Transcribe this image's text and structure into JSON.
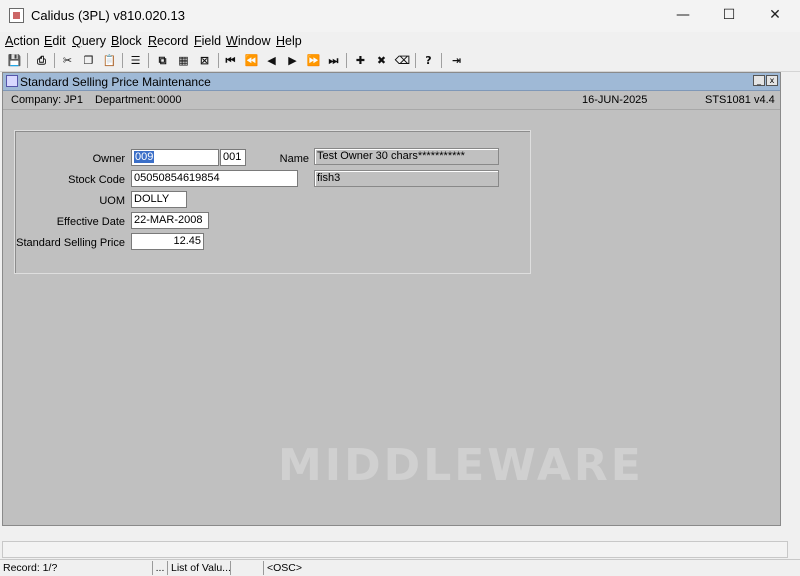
{
  "window": {
    "title": "Calidus (3PL) v810.020.13",
    "minimize_glyph": "—",
    "maximize_glyph": "☐",
    "close_glyph": "✕"
  },
  "menu": [
    {
      "accel": "A",
      "rest": "ction"
    },
    {
      "accel": "E",
      "rest": "dit"
    },
    {
      "accel": "Q",
      "rest": "uery"
    },
    {
      "accel": "B",
      "rest": "lock"
    },
    {
      "accel": "R",
      "rest": "ecord"
    },
    {
      "accel": "F",
      "rest": "ield"
    },
    {
      "accel": "W",
      "rest": "indow"
    },
    {
      "accel": "H",
      "rest": "elp"
    }
  ],
  "toolbar": {
    "save_icon": "💾",
    "print_icon": "⎙",
    "cut_icon": "✂",
    "copy_icon": "❐",
    "paste_icon": "📋",
    "clear_icon": "☰",
    "enter_query_icon": "⧉",
    "execute_query_icon": "▦",
    "cancel_query_icon": "⊠",
    "first_icon": "⏮",
    "prev_set_icon": "⏪",
    "prev_icon": "◀",
    "next_icon": "▶",
    "next_set_icon": "⏩",
    "last_icon": "⏭",
    "insert_icon": "✚",
    "delete_icon": "✖",
    "clear_record_icon": "⌫",
    "help_icon": "?",
    "exit_icon": "⇥"
  },
  "form": {
    "title": "Standard Selling Price Maintenance",
    "min_glyph": "_",
    "close_glyph": "x",
    "company_label": "Company:",
    "company_value": "JP1",
    "department_label": "Department:",
    "department_value": "0000",
    "date": "16-JUN-2025",
    "screen_code": "STS1081",
    "version": "v4.4",
    "fields": {
      "owner_label": "Owner",
      "owner_value": "009",
      "owner_site_value": "001",
      "name_label": "Name",
      "name_value": "Test Owner 30 chars***********",
      "stock_code_label": "Stock Code",
      "stock_code_value": "05050854619854",
      "stock_desc_value": "fish3",
      "uom_label": "UOM",
      "uom_value": "DOLLY",
      "effective_date_label": "Effective Date",
      "effective_date_value": "22-MAR-2008",
      "price_label": "Standard Selling Price",
      "price_value": "12.45"
    },
    "watermark": "MIDDLEWARE"
  },
  "status": {
    "record": "Record: 1/?",
    "dots": "...",
    "lov": "List of Valu...",
    "osc": "<OSC>"
  }
}
